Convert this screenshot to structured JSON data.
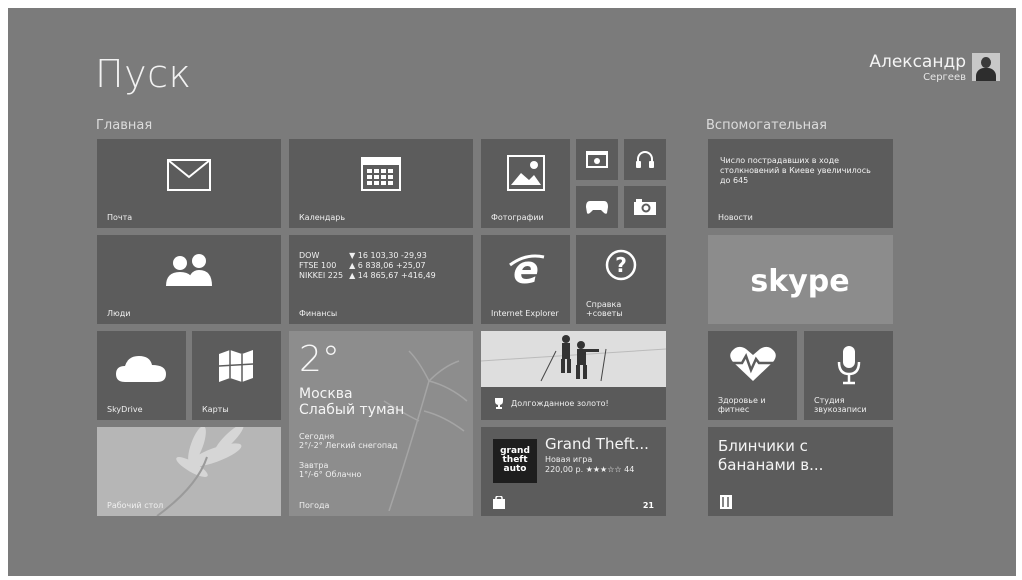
{
  "title": "Пуск",
  "user": {
    "name": "Александр",
    "surname": "Сергеев"
  },
  "groups": {
    "main": "Главная",
    "aux": "Вспомогательная"
  },
  "tiles": {
    "mail": "Почта",
    "calendar": "Календарь",
    "photos": "Фотографии",
    "people": "Люди",
    "finance": {
      "label": "Финансы",
      "rows": [
        {
          "name": "DOW",
          "arrow": "▼",
          "value": "16 103,30",
          "change": "-29,93"
        },
        {
          "name": "FTSE 100",
          "arrow": "▲",
          "value": "6 838,06",
          "change": "+25,07"
        },
        {
          "name": "NIKKEI 225",
          "arrow": "▲",
          "value": "14 865,67",
          "change": "+416,49"
        }
      ]
    },
    "ie": "Internet Explorer",
    "help": "Справка\n+советы",
    "skydrive": "SkyDrive",
    "maps": "Карты",
    "weather": {
      "temp": "2°",
      "city": "Москва",
      "condition": "Слабый туман",
      "today_label": "Сегодня",
      "today_fc": "2°/-2° Легкий снегопад",
      "tomorrow_label": "Завтра",
      "tomorrow_fc": "1°/-6° Облачно",
      "label": "Погода"
    },
    "sport_news": "Долгожданное золото!",
    "desktop": "Рабочий стол",
    "game": {
      "title": "Grand Theft...",
      "line1": "Новая игра",
      "line2": "220,00 р. ★★★☆☆ 44",
      "count": "21"
    },
    "news": {
      "text": "Число пострадавших в ходе столкновений в Киеве увеличилось до 645",
      "label": "Новости"
    },
    "skype": "skype",
    "health": "Здоровье и\nфитнес",
    "recorder": "Студия\nзвукозаписи",
    "recipe": "Блинчики с бананами в..."
  },
  "colors": {
    "background": "#7b7b7b",
    "tile": "#5c5c5c"
  }
}
